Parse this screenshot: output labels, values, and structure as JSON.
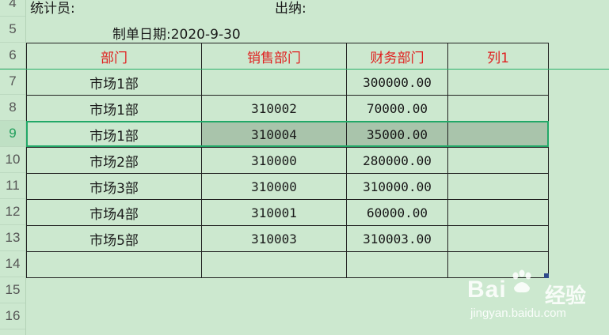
{
  "rows": [
    "4",
    "5",
    "6",
    "7",
    "8",
    "9",
    "10",
    "11",
    "12",
    "13",
    "14",
    "15",
    "16"
  ],
  "top": {
    "stat_label": "统计员:",
    "cashier_label": "出纳:",
    "date_label": "制单日期:2020-9-30"
  },
  "table": {
    "headers": [
      "部门",
      "销售部门",
      "财务部门",
      "列1"
    ],
    "rows": [
      {
        "dept": "市场1部",
        "sales": "",
        "finance": "300000.00",
        "col1": ""
      },
      {
        "dept": "市场1部",
        "sales": "310002",
        "finance": "70000.00",
        "col1": ""
      },
      {
        "dept": "市场1部",
        "sales": "310004",
        "finance": "35000.00",
        "col1": ""
      },
      {
        "dept": "市场2部",
        "sales": "310000",
        "finance": "280000.00",
        "col1": ""
      },
      {
        "dept": "市场3部",
        "sales": "310000",
        "finance": "310000.00",
        "col1": ""
      },
      {
        "dept": "市场4部",
        "sales": "310001",
        "finance": "60000.00",
        "col1": ""
      },
      {
        "dept": "市场5部",
        "sales": "310003",
        "finance": "310003.00",
        "col1": ""
      },
      {
        "dept": "",
        "sales": "",
        "finance": "",
        "col1": ""
      }
    ]
  },
  "watermark": {
    "logo": "Bai",
    "logo2": "经验",
    "url": "jingyan.baidu.com"
  },
  "colors": {
    "background": "#cce8cf",
    "header_text": "#e02020",
    "selection": "#22a868"
  }
}
